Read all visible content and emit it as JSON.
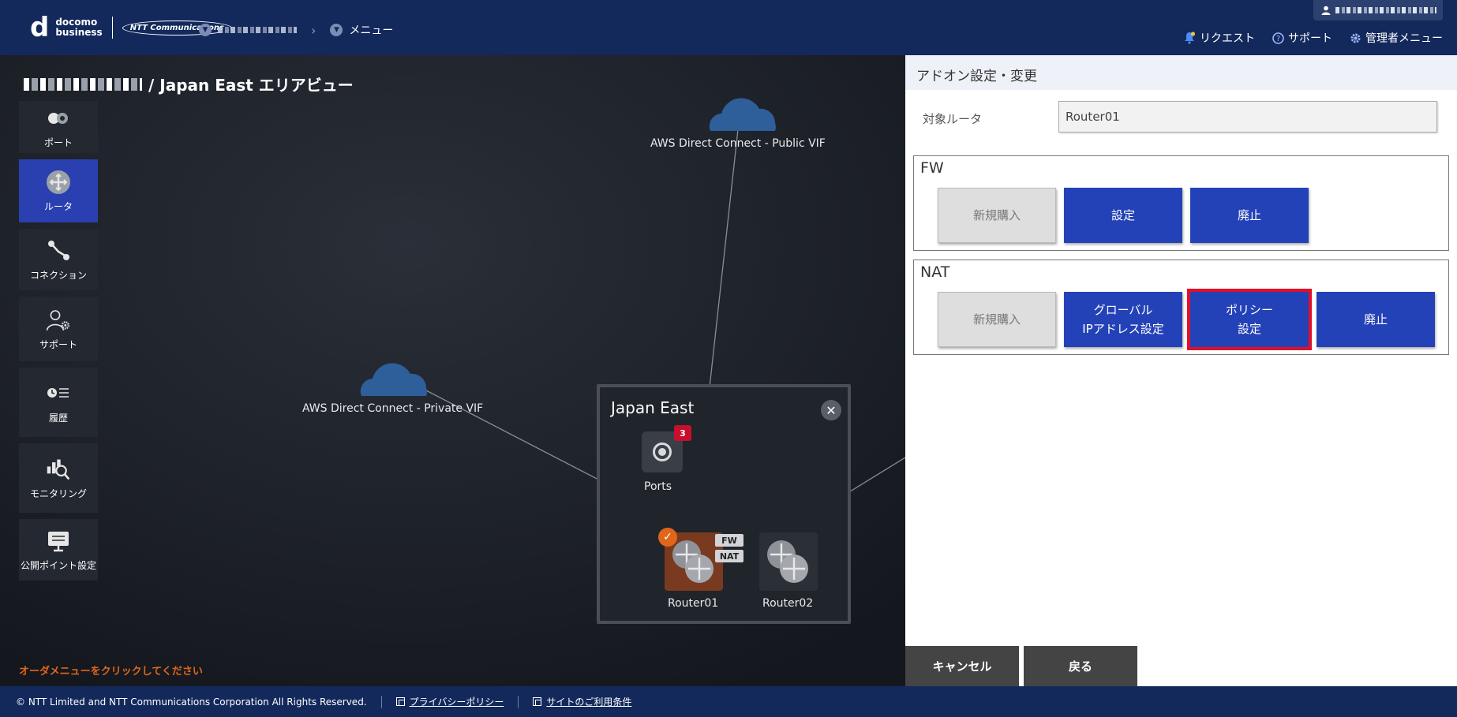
{
  "header": {
    "brand_docomo": "docomo",
    "brand_business": "business",
    "brand_ntt": "NTT Communications",
    "breadcrumb_menu": "メニュー",
    "links": [
      {
        "label": "リクエスト",
        "icon": "bell-icon"
      },
      {
        "label": "サポート",
        "icon": "help-icon"
      },
      {
        "label": "管理者メニュー",
        "icon": "gear-icon"
      }
    ]
  },
  "sidebar": {
    "items": [
      {
        "label": "ポート",
        "icon": "port-icon"
      },
      {
        "label": "ルータ",
        "icon": "router-icon",
        "active": true
      },
      {
        "label": "コネクション",
        "icon": "connection-icon"
      },
      {
        "label": "サポート",
        "icon": "support-icon"
      },
      {
        "label": "履歴",
        "icon": "history-icon"
      },
      {
        "label": "モニタリング",
        "icon": "monitoring-icon"
      },
      {
        "label": "公開ポイント設定",
        "icon": "public-point-icon"
      }
    ]
  },
  "map": {
    "title_suffix": "/ Japan East エリアビュー",
    "clouds": [
      {
        "label": "AWS Direct Connect - Public VIF"
      },
      {
        "label": "AWS Direct Connect - Private VIF"
      }
    ],
    "area": {
      "title": "Japan East",
      "ports_label": "Ports",
      "ports_count": "3",
      "routers": [
        {
          "label": "Router01",
          "selected": true,
          "tags": [
            "FW",
            "NAT"
          ]
        },
        {
          "label": "Router02",
          "selected": false
        }
      ]
    },
    "hint": "オーダメニューをクリックしてください"
  },
  "panel": {
    "title": "アドオン設定・変更",
    "target_label": "対象ルータ",
    "target_value": "Router01",
    "fw": {
      "title": "FW",
      "buttons": [
        "新規購入",
        "設定",
        "廃止"
      ]
    },
    "nat": {
      "title": "NAT",
      "buttons": [
        "新規購入",
        "グローバル\nIPアドレス設定",
        "ポリシー\n設定",
        "廃止"
      ]
    },
    "cancel_label": "キャンセル",
    "back_label": "戻る"
  },
  "footer": {
    "copyright": "© NTT Limited and NTT Communications Corporation All Rights Reserved.",
    "privacy": "プライバシーポリシー",
    "terms": "サイトのご利用条件"
  },
  "colors": {
    "header_bg": "#13295c",
    "accent_blue": "#2442b8",
    "selected_router": "#7a3a1f",
    "highlight_red": "#e0102a",
    "hint_orange": "#e0661c"
  }
}
